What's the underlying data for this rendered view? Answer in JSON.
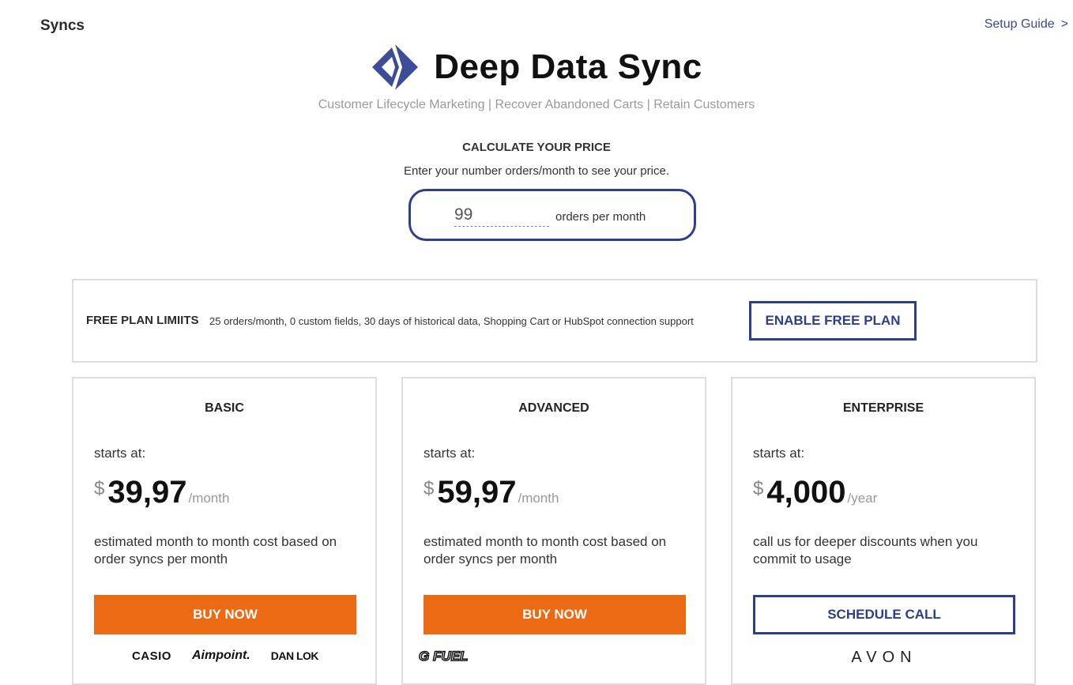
{
  "header": {
    "page_title": "Syncs",
    "setup_link": "Setup Guide",
    "setup_chevron": ">"
  },
  "brand": {
    "name": "Deep Data Sync",
    "logo_icon": "diamond-logo-icon",
    "color": "#3d4c96",
    "tagline": "Customer Lifecycle Marketing | Recover Abandoned Carts | Retain Customers"
  },
  "calculator": {
    "heading": "CALCULATE YOUR PRICE",
    "subheading": "Enter your number orders/month to see your price.",
    "orders_value": "99",
    "orders_label": "orders per month"
  },
  "free_plan": {
    "title": "FREE PLAN LIMIITS",
    "description": "25 orders/month, 0 custom fields, 30 days of historical data, Shopping Cart or HubSpot connection support",
    "button": "ENABLE FREE PLAN"
  },
  "plans": [
    {
      "name": "BASIC",
      "starts_label": "starts at:",
      "currency": "$",
      "amount": "39,97",
      "period": "/month",
      "description": "estimated month to month cost based on order syncs per month",
      "button": "BUY NOW",
      "logos": [
        "CASIO",
        "Aimpoint.",
        "DAN LOK"
      ]
    },
    {
      "name": "ADVANCED",
      "starts_label": "starts at:",
      "currency": "$",
      "amount": "59,97",
      "period": "/month",
      "description": "estimated month to month cost based on order syncs per month",
      "button": "BUY NOW",
      "logos": [
        "G FUEL"
      ]
    },
    {
      "name": "ENTERPRISE",
      "starts_label": "starts at:",
      "currency": "$",
      "amount": "4,000",
      "period": "/year",
      "description": "call us for deeper discounts when you commit to usage",
      "button": "SCHEDULE CALL",
      "logos": [
        "AVON"
      ]
    }
  ],
  "colors": {
    "accent_blue": "#2d3f8a",
    "buy_orange": "#ec6a14",
    "border_gray": "#dddddd"
  }
}
